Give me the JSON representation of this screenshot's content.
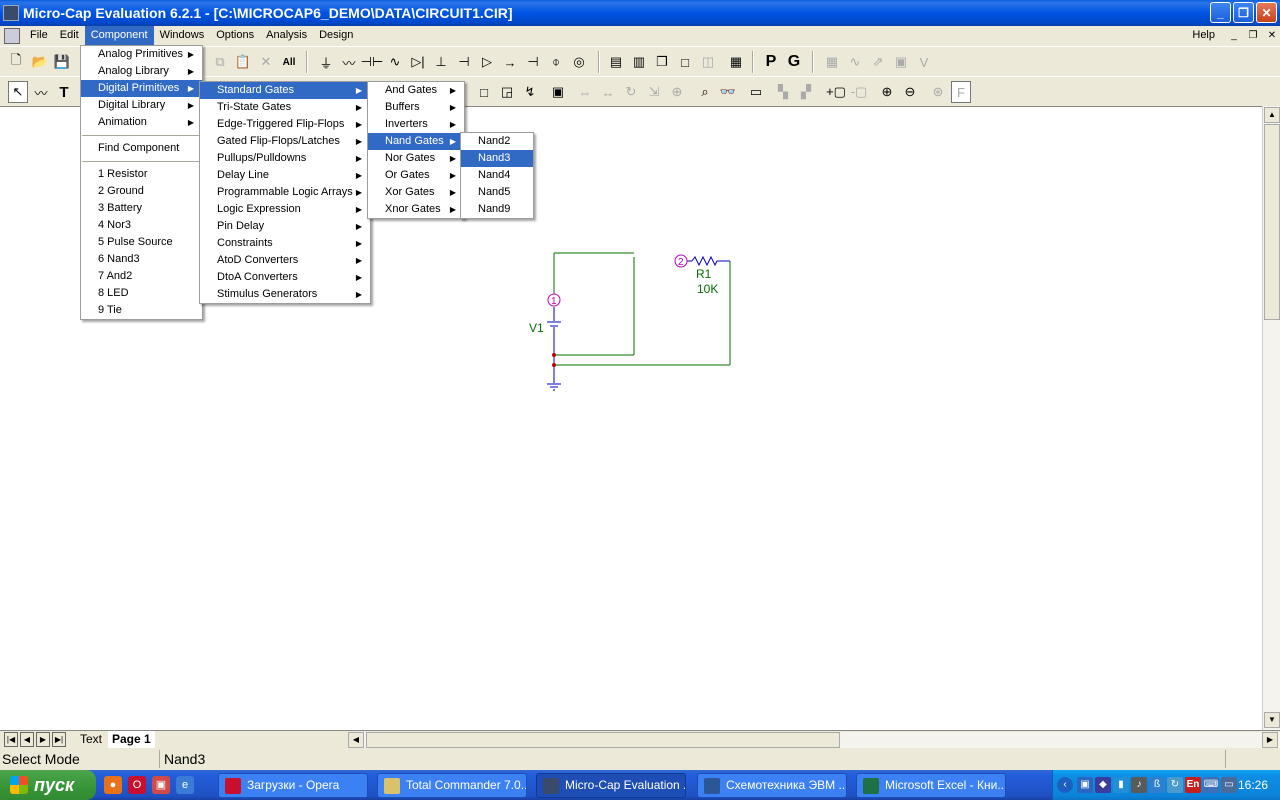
{
  "window": {
    "title": "Micro-Cap Evaluation 6.2.1 - [C:\\MICROCAP6_DEMO\\DATA\\CIRCUIT1.CIR]",
    "minimize": "_",
    "maximize": "❐",
    "close": "✕"
  },
  "menubar": {
    "items": [
      "File",
      "Edit",
      "Component",
      "Windows",
      "Options",
      "Analysis",
      "Design"
    ],
    "help": "Help",
    "mdi_minimize": "_",
    "mdi_restore": "❐",
    "mdi_close": "✕"
  },
  "toolbar": {
    "print_label": "P",
    "graph_label": "G"
  },
  "component_menu": {
    "items": [
      "Analog Primitives",
      "Analog Library",
      "Digital Primitives",
      "Digital Library",
      "Animation"
    ],
    "find": "Find Component",
    "recent": [
      "1 Resistor",
      "2 Ground",
      "3 Battery",
      "4 Nor3",
      "5 Pulse Source",
      "6 Nand3",
      "7 And2",
      "8 LED",
      "9 Tie"
    ]
  },
  "digital_primitives_menu": {
    "items": [
      "Standard Gates",
      "Tri-State Gates",
      "Edge-Triggered Flip-Flops",
      "Gated Flip-Flops/Latches",
      "Pullups/Pulldowns",
      "Delay Line",
      "Programmable Logic Arrays",
      "Logic Expression",
      "Pin Delay",
      "Constraints",
      "AtoD Converters",
      "DtoA Converters",
      "Stimulus Generators"
    ]
  },
  "standard_gates_menu": {
    "items": [
      "And Gates",
      "Buffers",
      "Inverters",
      "Nand Gates",
      "Nor Gates",
      "Or Gates",
      "Xor Gates",
      "Xnor Gates"
    ]
  },
  "nand_gates_menu": {
    "items": [
      "Nand2",
      "Nand3",
      "Nand4",
      "Nand5",
      "Nand9"
    ]
  },
  "circuit": {
    "node1": "1",
    "node2": "2",
    "v1_label": "V1",
    "r1_label": "R1",
    "r1_value": "10K",
    "wire_color": "#007000",
    "node_color": "#c000c0",
    "component_color": "#0000c0",
    "junction_color": "#c00000"
  },
  "page_tabs": {
    "first": "|◀",
    "prev": "◀",
    "next": "▶",
    "last": "▶|",
    "tabs": [
      "Text",
      "Page 1"
    ]
  },
  "statusbar": {
    "mode": "Select Mode",
    "message": "Nand3"
  },
  "taskbar": {
    "start": "пуск",
    "items": [
      "Загрузки - Opera",
      "Total Commander 7.0...",
      "Micro-Cap Evaluation ...",
      "Схемотехника ЭВМ ...",
      "Microsoft Excel - Кни..."
    ],
    "lang": "En",
    "clock": "16:26"
  }
}
